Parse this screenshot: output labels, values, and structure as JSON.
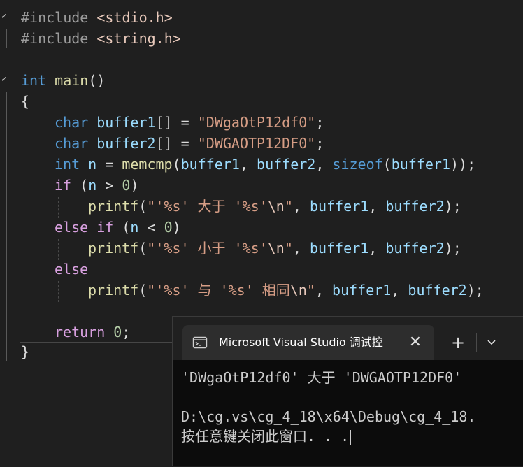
{
  "editor": {
    "line1": {
      "directive": "#include",
      "header": "<stdio.h>"
    },
    "line2": {
      "directive": "#include",
      "header": "<string.h>"
    },
    "line4": {
      "type": "int",
      "name": "main",
      "parens": "()"
    },
    "line5": {
      "brace": "{"
    },
    "line6": {
      "type": "char",
      "var": "buffer1",
      "rest": "[] = ",
      "str": "\"DWgaOtP12df0\"",
      "end": ";"
    },
    "line7": {
      "type": "char",
      "var": "buffer2",
      "rest": "[] = ",
      "str": "\"DWGAOTP12DF0\"",
      "end": ";"
    },
    "line8": {
      "type": "int",
      "var": "n",
      "eq": " = ",
      "fn": "memcmp",
      "open": "(",
      "a1": "buffer1",
      "sep1": ", ",
      "a2": "buffer2",
      "sep2": ", ",
      "kw": "sizeof",
      "open2": "(",
      "a3": "buffer1",
      "close": "));"
    },
    "line9": {
      "kw": "if",
      "open": " (",
      "var": "n",
      "op": " > ",
      "num": "0",
      "close": ")"
    },
    "line10": {
      "fn": "printf",
      "open": "(",
      "s1": "\"'%s' 大于 '%s'",
      "esc": "\\n",
      "s2": "\"",
      "sep1": ", ",
      "a1": "buffer1",
      "sep2": ", ",
      "a2": "buffer2",
      "close": ");"
    },
    "line11": {
      "kw1": "else",
      "kw2": "if",
      "open": " (",
      "var": "n",
      "op": " < ",
      "num": "0",
      "close": ")"
    },
    "line12": {
      "fn": "printf",
      "open": "(",
      "s1": "\"'%s' 小于 '%s'",
      "esc": "\\n",
      "s2": "\"",
      "sep1": ", ",
      "a1": "buffer1",
      "sep2": ", ",
      "a2": "buffer2",
      "close": ");"
    },
    "line13": {
      "kw": "else"
    },
    "line14": {
      "fn": "printf",
      "open": "(",
      "s1": "\"'%s' 与 '%s' 相同",
      "esc": "\\n",
      "s2": "\"",
      "sep1": ", ",
      "a1": "buffer1",
      "sep2": ", ",
      "a2": "buffer2",
      "close": ");"
    },
    "line16": {
      "kw": "return",
      "num": "0",
      "end": ";"
    },
    "line17": {
      "brace": "}"
    },
    "check_mark": "✓"
  },
  "console": {
    "tab_title": "Microsoft Visual Studio 调试控",
    "close_symbol": "✕",
    "new_tab_symbol": "+",
    "output": [
      "'DWgaOtP12df0' 大于 'DWGAOTP12DF0'",
      "",
      "D:\\cg.vs\\cg_4_18\\x64\\Debug\\cg_4_18.",
      "按任意键关闭此窗口. . ."
    ]
  },
  "icons": {
    "terminal": "terminal-icon",
    "chevron": "chevron-down-icon",
    "check": "check-icon"
  }
}
